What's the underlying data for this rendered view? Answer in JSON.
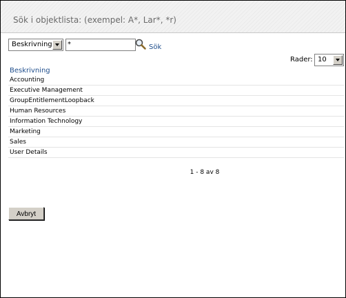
{
  "header": {
    "title": "Sök i objektlista: (exempel: A*, Lar*, *r)"
  },
  "search": {
    "attribute_selected": "Beskrivning",
    "query_value": "*",
    "search_label": "Sök"
  },
  "rows": {
    "label": "Rader:",
    "selected": "10"
  },
  "table": {
    "column_header": "Beskrivning",
    "items": [
      "Accounting",
      "Executive Management",
      "GroupEntitlementLoopback",
      "Human Resources",
      "Information Technology",
      "Marketing",
      "Sales",
      "User Details"
    ]
  },
  "pager": {
    "text": "1 - 8 av 8"
  },
  "footer": {
    "cancel_label": "Avbryt"
  },
  "icons": {
    "search": "magnifier-icon",
    "dropdown": "chevron-down-icon"
  },
  "colors": {
    "link": "#1f4e8c",
    "header_bg": "#f2f2f2",
    "header_text": "#6a6a6a"
  }
}
